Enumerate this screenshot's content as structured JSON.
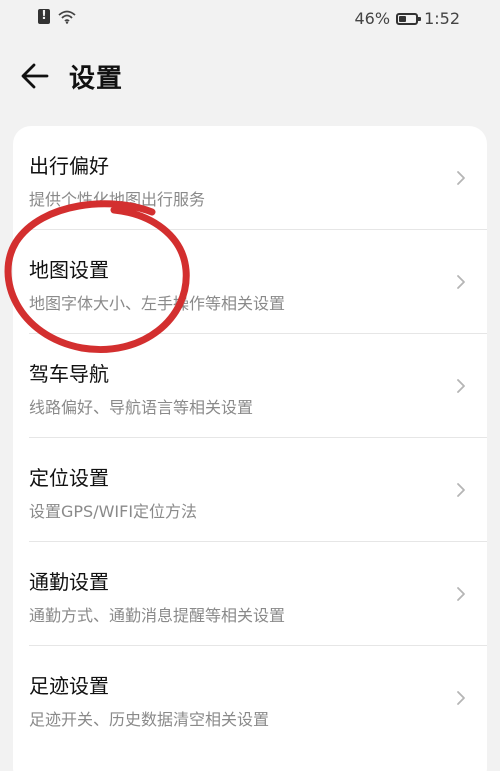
{
  "status_bar": {
    "battery_percent": "46%",
    "battery_level": 0.46,
    "time": "1:52",
    "icons": [
      "sim-alert-icon",
      "wifi-icon",
      "battery-icon"
    ]
  },
  "header": {
    "title": "设置",
    "back_icon": "arrow-left-icon"
  },
  "settings": {
    "items": [
      {
        "title": "出行偏好",
        "desc": "提供个性化地图出行服务"
      },
      {
        "title": "地图设置",
        "desc": "地图字体大小、左手操作等相关设置"
      },
      {
        "title": "驾车导航",
        "desc": "线路偏好、导航语言等相关设置"
      },
      {
        "title": "定位设置",
        "desc": "设置GPS/WIFI定位方法"
      },
      {
        "title": "通勤设置",
        "desc": "通勤方式、通勤消息提醒等相关设置"
      },
      {
        "title": "足迹设置",
        "desc": "足迹开关、历史数据清空相关设置"
      }
    ]
  },
  "colors": {
    "background": "#f2f2f2",
    "card": "#ffffff",
    "annotation": "#d32f2f",
    "secondary_text": "#8a8a8a"
  }
}
